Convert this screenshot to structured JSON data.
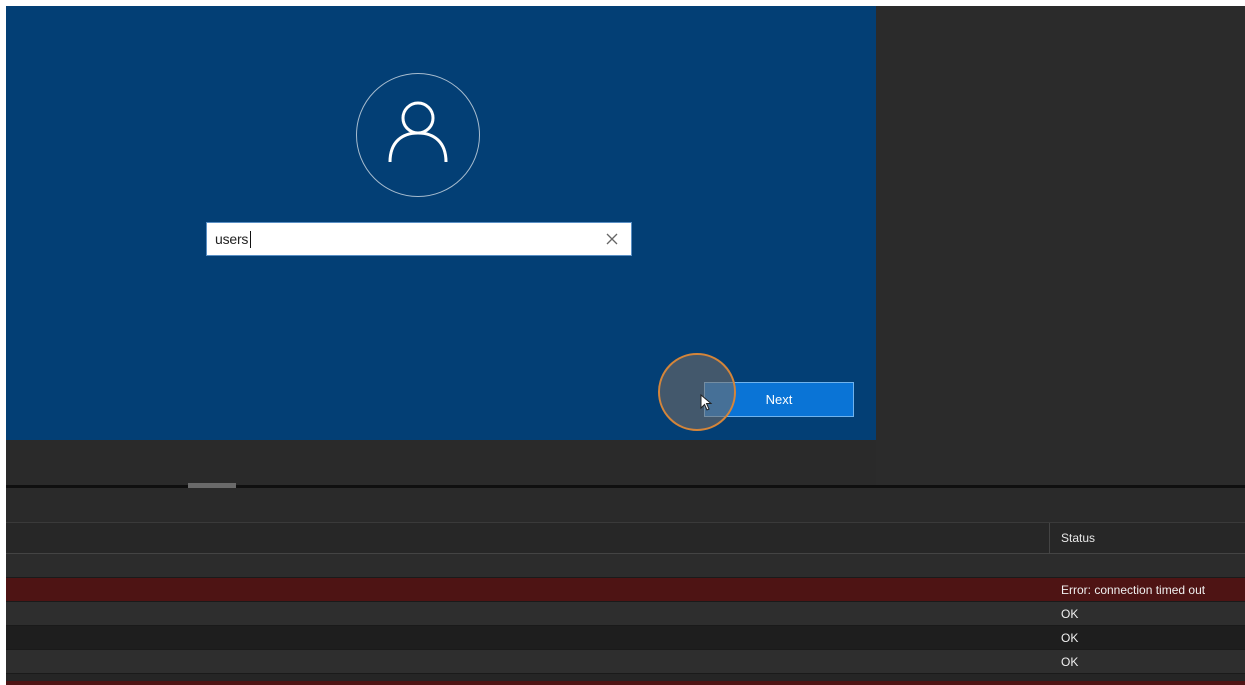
{
  "login": {
    "username_value": "users",
    "next_label": "Next"
  },
  "log_table": {
    "status_header": "Status",
    "rows": [
      {
        "status": ""
      },
      {
        "status": "Error: connection timed out"
      },
      {
        "status": "OK"
      },
      {
        "status": "OK"
      },
      {
        "status": "OK"
      }
    ]
  },
  "colors": {
    "screen_bg": "#033f75",
    "next_button": "#0a74d6",
    "error_row": "#4e1414",
    "click_ring": "#d4853a"
  },
  "icons": {
    "avatar": "user-icon",
    "clear": "close-icon",
    "cursor": "mouse-pointer-icon"
  }
}
